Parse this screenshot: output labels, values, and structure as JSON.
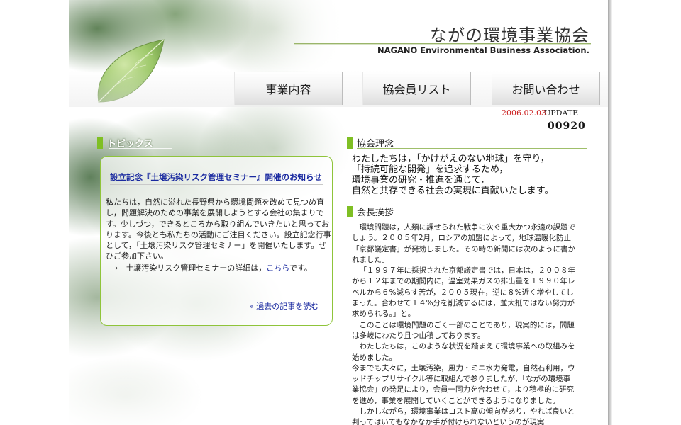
{
  "header": {
    "title": "ながの環境事業協会",
    "subtitle": "NAGANO Environmental Business Association."
  },
  "nav": {
    "items": [
      {
        "label": "事業内容"
      },
      {
        "label": "協会員リスト"
      },
      {
        "label": "お問い合わせ"
      }
    ]
  },
  "update": {
    "date": "2006.02.03",
    "label": "UPDATE",
    "counter": "00920"
  },
  "topics": {
    "heading": "トピックス",
    "link": "設立記念『土壌汚染リスク管理セミナー』開催のお知らせ",
    "body": "私たちは，自然に溢れた長野県から環境問題を改めて見つめ直し，問題解決のための事業を展開しようとする会社の集まりです。少しづつ，できるところから取り組んでいきたいと思っております。今後とも私たちの活動にご注目ください。設立記念行事として，「土壌汚染リスク管理セミナー」を開催いたします。ぜひご参加下さい。",
    "detail_prefix": "→　土壌汚染リスク管理セミナーの詳細は，",
    "detail_link": "こちら",
    "detail_suffix": "です。",
    "past_link": "» 過去の記事を読む"
  },
  "rinen": {
    "heading": "協会理念",
    "lines": [
      "わたしたちは，「かけがえのない地球」を守り，",
      "「持続可能な開発」を追求するため，",
      "環境事業の研究・推進を通じて，",
      "自然と共存できる社会の実現に貢献いたします。"
    ]
  },
  "aisatsu": {
    "heading": "会長挨拶",
    "paragraphs": [
      "環境問題は，人類に課せられた戦争に次ぐ重大かつ永遠の課題でしょう。２００５年2月，ロシアの加盟によって，地球温暖化防止「京都議定書」が発効しました。その時の新聞には次のように書かれました。",
      "「１９９７年に採択された京都議定書では，日本は，２００８年から１２年までの期間内に，温室効果ガスの排出量を１９９０年レベルから６%減らす苦が，２００５現在，逆に８%近く増やしてしまった。合わせて１４%分を削減するには，並大抵ではない努力が求められる。」と。",
      "このことは環境問題のごく一部のことであり，現実的には，問題は多岐にわたり且つ山積しております。",
      "わたしたちは，このような状況を踏まえて環境事業への取組みを始めました。",
      "今までも夫々に，土壌汚染，風力・ミニ水力発電，自然石利用，ウッドチップリサイクル等に取組んで参りましたが，「ながの環境事業協会」の発足により，会員一同力を合わせて，より積極的に研究を進め，事業を展開していくことができるようになりました。",
      "しかしながら，環境事業はコスト高の傾向があり，やれば良いと判ってはいてもなかなか手が付けられないというのが現実"
    ]
  },
  "colors": {
    "accent_green": "#7fbf24",
    "link_blue": "#1a2aa0",
    "update_red": "#cc2222"
  }
}
